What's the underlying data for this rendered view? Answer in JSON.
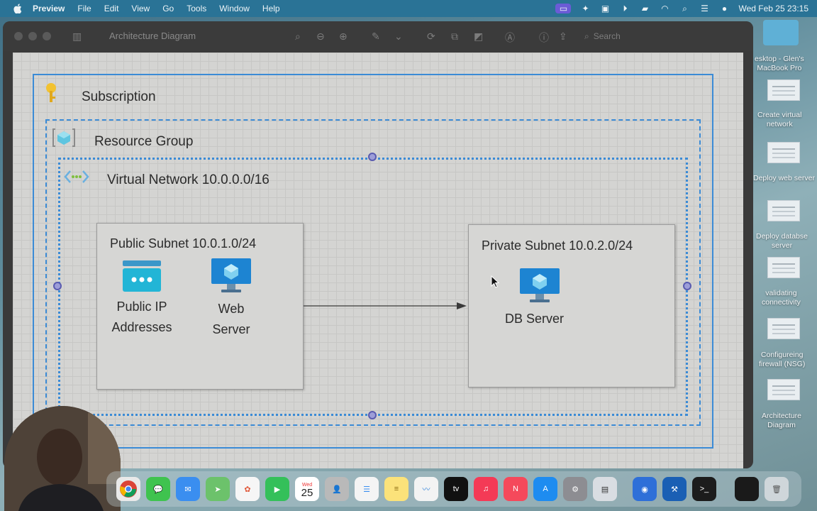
{
  "menubar": {
    "app_name": "Preview",
    "menus": [
      "File",
      "Edit",
      "View",
      "Go",
      "Tools",
      "Window",
      "Help"
    ],
    "clock": "Wed Feb 25  23:15",
    "status_icons": [
      "screen-mirroring-icon",
      "ai-sparkle-icon",
      "control-icon",
      "play-icon",
      "battery-icon",
      "wifi-icon",
      "search-icon",
      "control-center-icon",
      "siri-icon"
    ]
  },
  "window": {
    "title": "Architecture Diagram",
    "search_placeholder": "Search"
  },
  "diagram": {
    "subscription_label": "Subscription",
    "resource_group_label": "Resource Group",
    "vnet_label": "Virtual Network 10.0.0.0/16",
    "public_subnet": {
      "title": "Public Subnet 10.0.1.0/24",
      "public_ip_label_line1": "Public IP",
      "public_ip_label_line2": "Addresses",
      "web_server_label_line1": "Web",
      "web_server_label_line2": "Server"
    },
    "private_subnet": {
      "title": "Private Subnet 10.0.2.0/24",
      "db_server_label": "DB Server"
    },
    "colors": {
      "container_border": "#3b8bd6",
      "handle_fill": "#9d9ed8",
      "public_ip_icon": "#22b5d6",
      "server_icon": "#1d84d2",
      "key_icon": "#f2c230"
    }
  },
  "desktop": {
    "items": [
      {
        "label_line1": "esktop - Glen's",
        "label_line2": "MacBook Pro"
      },
      {
        "label_line1": "Create virtual",
        "label_line2": "network"
      },
      {
        "label_line1": "Deploy web server",
        "label_line2": ""
      },
      {
        "label_line1": "Deploy databse",
        "label_line2": "server"
      },
      {
        "label_line1": "validating",
        "label_line2": "connectivity"
      },
      {
        "label_line1": "Configureing",
        "label_line2": "firewall (NSG)"
      },
      {
        "label_line1": "Architecture",
        "label_line2": "Diagram"
      }
    ]
  },
  "dock": {
    "calendar_day": "25",
    "calendar_month": "Wed",
    "apps": [
      "chrome-icon",
      "messages-icon",
      "mail-icon",
      "maps-icon",
      "photos-icon",
      "facetime-icon",
      "calendar-icon",
      "contacts-icon",
      "reminders-icon",
      "notes-icon",
      "freeform-icon",
      "apple-tv-icon",
      "music-icon",
      "news-icon",
      "app-store-icon",
      "system-settings-icon",
      "preview-app-icon",
      "screen-sharing-icon",
      "xcode-icon",
      "terminal-icon",
      "window-icon",
      "trash-icon"
    ]
  }
}
